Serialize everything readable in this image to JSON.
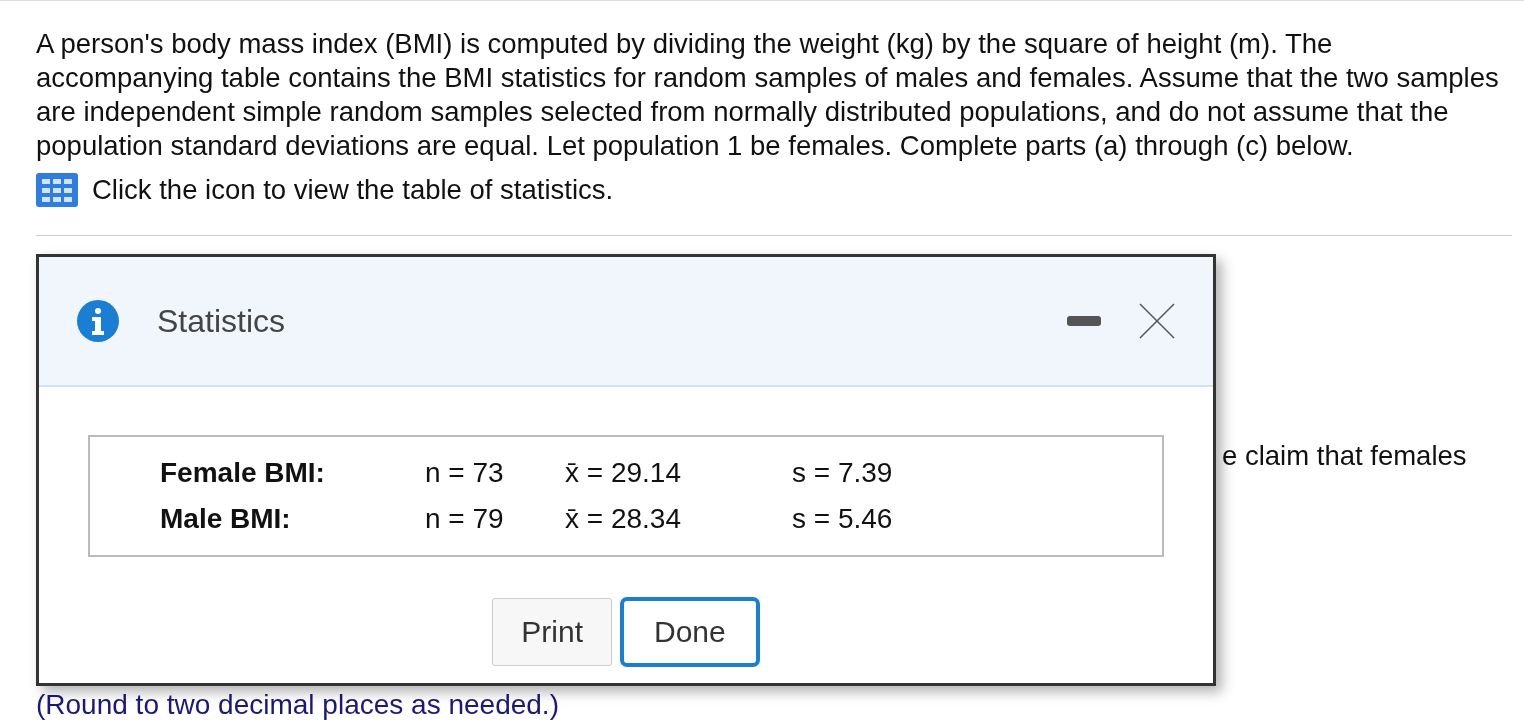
{
  "question": {
    "text": "A person's body mass index (BMI) is computed by dividing the weight (kg) by the square of height (m). The accompanying table contains the BMI statistics for random samples of males and females. Assume that the two samples are independent simple random samples selected from normally distributed populations, and do not assume that the population standard deviations are equal. Let population 1 be females. Complete parts (a) through (c) below.",
    "table_link": "Click the icon to view the table of statistics."
  },
  "behind_text": "e claim that females",
  "footer_hint": "(Round to two decimal places as needed.)",
  "dialog": {
    "title": "Statistics",
    "rows": [
      {
        "label": "Female BMI:",
        "n": "n = 73",
        "mean": "x̄ = 29.14",
        "sd": "s = 7.39"
      },
      {
        "label": "Male BMI:",
        "n": "n = 79",
        "mean": "x̄ = 28.34",
        "sd": "s = 5.46"
      }
    ],
    "buttons": [
      {
        "label": "Print",
        "selected": false
      },
      {
        "label": "Done",
        "selected": true
      }
    ]
  }
}
